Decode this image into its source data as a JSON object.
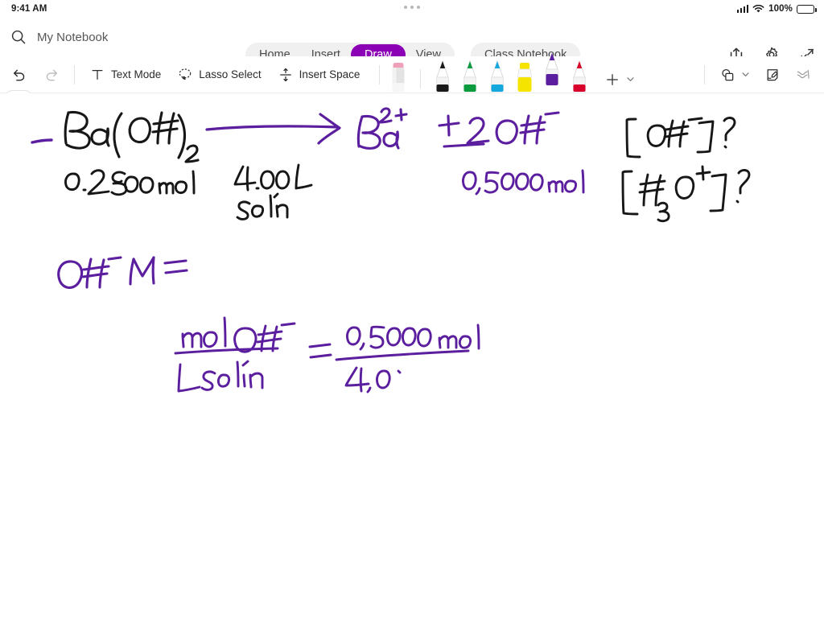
{
  "status_bar": {
    "time": "9:41 AM",
    "battery_percent": "100%",
    "signal_icon": "cellular-signal-icon",
    "wifi_icon": "wifi-icon",
    "battery_icon": "battery-icon"
  },
  "header": {
    "search_icon": "search-icon",
    "notebook_title": "My Notebook",
    "tabs": [
      {
        "label": "Home",
        "active": false
      },
      {
        "label": "Insert",
        "active": false
      },
      {
        "label": "Draw",
        "active": true
      },
      {
        "label": "View",
        "active": false
      }
    ],
    "secondary_tab": "Class Notebook",
    "actions": [
      {
        "name": "share-icon"
      },
      {
        "name": "gear-icon"
      },
      {
        "name": "collapse-icon"
      }
    ]
  },
  "toolbar": {
    "undo_label": "",
    "redo_label": "",
    "items": [
      {
        "icon": "undo-icon",
        "label": "",
        "disabled": false
      },
      {
        "icon": "redo-icon",
        "label": "",
        "disabled": true
      }
    ],
    "text_mode_label": "Text Mode",
    "lasso_select_label": "Lasso Select",
    "insert_space_label": "Insert Space",
    "pens": [
      {
        "name": "eraser",
        "color": "#f3a8bd",
        "body": "#e9e9e9",
        "selected": false
      },
      {
        "name": "pen-black",
        "color": "#1a1a1a",
        "body": "#1a1a1a",
        "selected": false
      },
      {
        "name": "pen-green",
        "color": "#0a9b3f",
        "body": "#0a9b3f",
        "selected": false
      },
      {
        "name": "pen-blue",
        "color": "#15a8dd",
        "body": "#15a8dd",
        "selected": false
      },
      {
        "name": "highlighter-yellow",
        "color": "#f5e400",
        "body": "#f5e400",
        "selected": false
      },
      {
        "name": "pen-purple",
        "color": "#5b1e9e",
        "body": "#5b1e9e",
        "selected": true
      },
      {
        "name": "pen-red",
        "color": "#d9002b",
        "body": "#d9002b",
        "selected": false
      }
    ],
    "add_pen_label": "+",
    "shapes_icon": "shapes-icon",
    "ink_to_shape_icon": "ink-to-shape-icon",
    "ink_to_text_icon": "ink-to-text-icon"
  },
  "canvas": {
    "back_button": "back-chevron-icon",
    "ink_colors": {
      "black": "#171717",
      "purple": "#5B1E9E"
    },
    "handwriting": {
      "reactant": "Ba(OH)2",
      "reactant_moles": "0.250 mol",
      "volume": "4.00 L",
      "volume_sub": "soln",
      "arrow": "→",
      "product_cation": "Ba 2+",
      "product_plus": "+",
      "product_coefficient": "2",
      "product_anion": "OH -",
      "product_moles": "0.500 mol",
      "question_1": "[OH-] ?",
      "question_2": "[H3O+] ?",
      "work_lhs": "OH- M =",
      "work_numerator": "mol OH-",
      "work_denominator": "L soln",
      "work_equals": "=",
      "work_value_numerator": "0.500 mol",
      "work_value_denominator": "4.0"
    }
  }
}
